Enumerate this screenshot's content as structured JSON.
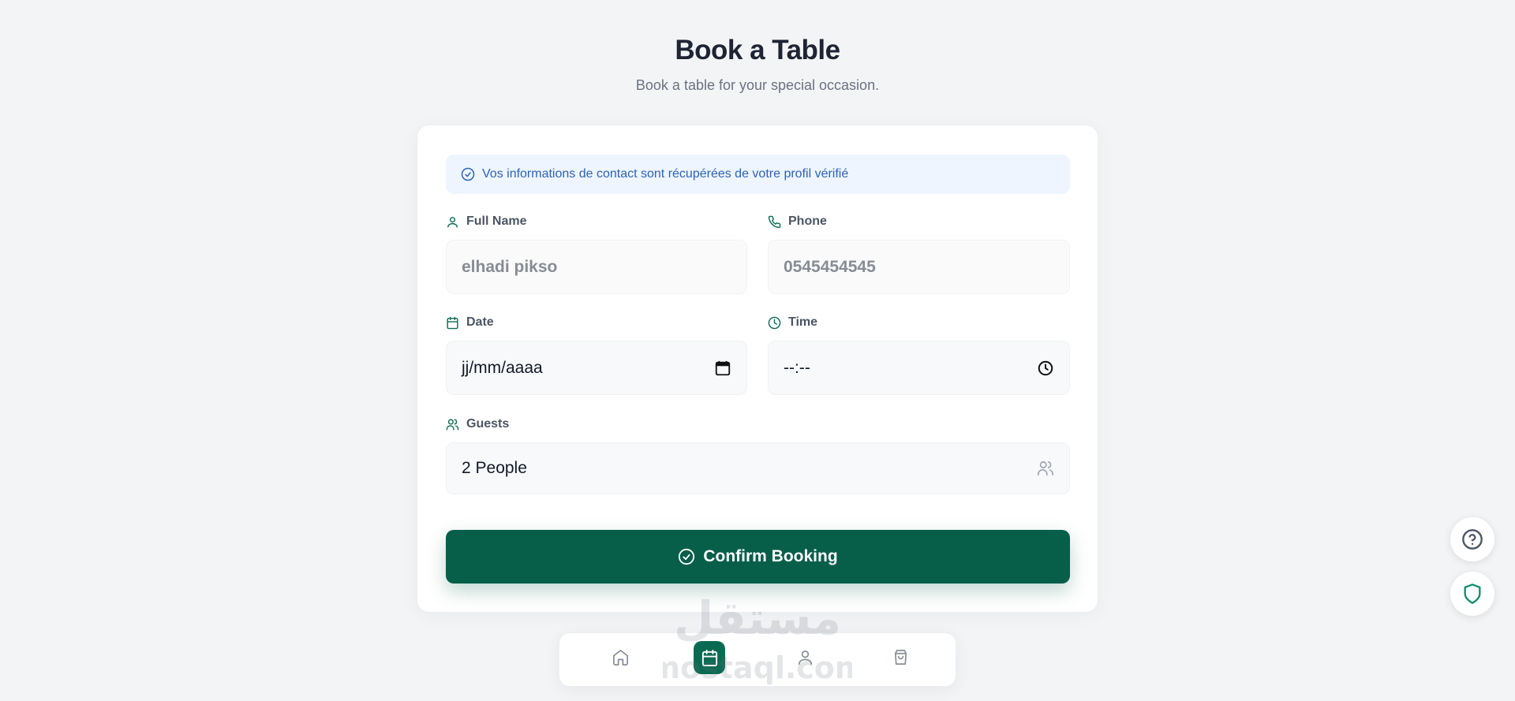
{
  "header": {
    "title": "Book a Table",
    "subtitle": "Book a table for your special occasion."
  },
  "notice": {
    "text": "Vos informations de contact sont récupérées de votre profil vérifié",
    "icon": "check-circle-icon"
  },
  "form": {
    "full_name": {
      "label": "Full Name",
      "value": "elhadi pikso",
      "icon": "user-icon"
    },
    "phone": {
      "label": "Phone",
      "value": "0545454545",
      "icon": "phone-icon"
    },
    "date": {
      "label": "Date",
      "placeholder": "jj/mm/aaaa",
      "icon": "calendar-icon"
    },
    "time": {
      "label": "Time",
      "placeholder": "--:--",
      "icon": "clock-icon"
    },
    "guests": {
      "label": "Guests",
      "value": "2 People",
      "icon": "users-icon"
    }
  },
  "confirm_button": {
    "label": "Confirm Booking"
  },
  "bottom_nav": {
    "items": [
      "home-icon",
      "calendar-icon",
      "user-icon",
      "shopping-bag-icon"
    ],
    "active_index": 1
  },
  "watermark": {
    "text_top": "مستقل",
    "text_bottom": "mostaql.com"
  },
  "colors": {
    "brand": "#075e49",
    "notice_bg": "#eef5fe",
    "notice_text": "#2d62b8",
    "background": "#f3f4f6"
  }
}
